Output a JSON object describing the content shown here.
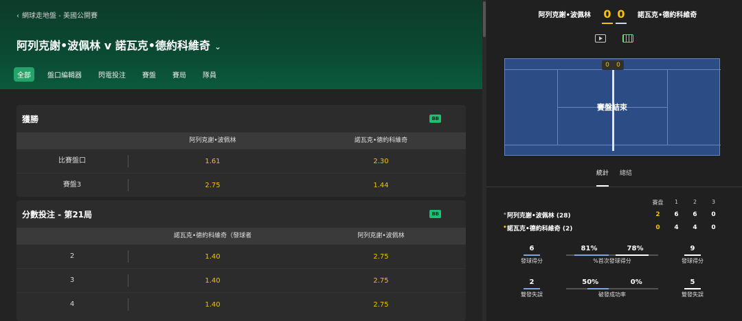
{
  "header": {
    "breadcrumb": "網球走地盤 - 美國公開賽",
    "title": "阿列克謝•波佩林 v 諾瓦克•德約科維奇",
    "tabs": [
      "全部",
      "盤口編輯器",
      "閃電投注",
      "賽盤",
      "賽局",
      "隊員"
    ],
    "active_tab": "全部"
  },
  "markets": [
    {
      "title": "獲勝",
      "badge": "BB",
      "columns": [
        "阿列克謝•波佩林",
        "諾瓦克•德約科維奇"
      ],
      "rows": [
        {
          "label": "比賽盤口",
          "odds": [
            "1.61",
            "2.30"
          ]
        },
        {
          "label": "賽盤3",
          "odds": [
            "2.75",
            "1.44"
          ]
        }
      ]
    },
    {
      "title": "分數投注 - 第21局",
      "badge": "BB",
      "columns": [
        "諾瓦克•德約科維奇（發球者",
        "阿列克謝•波佩林"
      ],
      "rows": [
        {
          "label": "2",
          "odds": [
            "1.40",
            "2.75"
          ]
        },
        {
          "label": "3",
          "odds": [
            "1.40",
            "2.75"
          ]
        },
        {
          "label": "4",
          "odds": [
            "1.40",
            "2.75"
          ]
        }
      ]
    }
  ],
  "scoreboard": {
    "player1": "阿列克謝•波佩林",
    "player2": "諾瓦克•德約科維奇",
    "score1": "0",
    "score2": "0",
    "court_score1": "0",
    "court_score2": "0",
    "court_message": "賽盤結束",
    "icons": [
      "play-icon",
      "court-icon"
    ]
  },
  "stats": {
    "tabs": [
      "統計",
      "總結"
    ],
    "active_tab": "統計",
    "set_header": [
      "賽盘",
      "1",
      "2",
      "3"
    ],
    "players": [
      {
        "dot": "•",
        "name": "阿列克謝•波佩林 (28)",
        "sets": [
          "2",
          "6",
          "6",
          "0"
        ]
      },
      {
        "dot": "•",
        "name": "諾瓦克•德約科維奇 (2)",
        "sets": [
          "0",
          "4",
          "4",
          "0"
        ]
      }
    ],
    "aces": {
      "p1": "6",
      "p2": "9",
      "label_left": "發球得分",
      "label_right": "發球得分"
    },
    "first_serve": {
      "p1": "81%",
      "p2": "78%",
      "label": "%首次發球得分",
      "p1_frac": 0.81,
      "p2_frac": 0.78
    },
    "double_faults": {
      "p1": "2",
      "p2": "5",
      "label_left": "雙發失誤",
      "label_right": "雙發失誤"
    },
    "break_points": {
      "p1": "50%",
      "p2": "0%",
      "label": "破發成功率",
      "p1_frac": 0.5,
      "p2_frac": 0.0
    },
    "colors": {
      "p1": "#7ea6e0",
      "p2": "#ffffff",
      "accent": "#f4c20d",
      "brand": "#24a46a"
    }
  }
}
